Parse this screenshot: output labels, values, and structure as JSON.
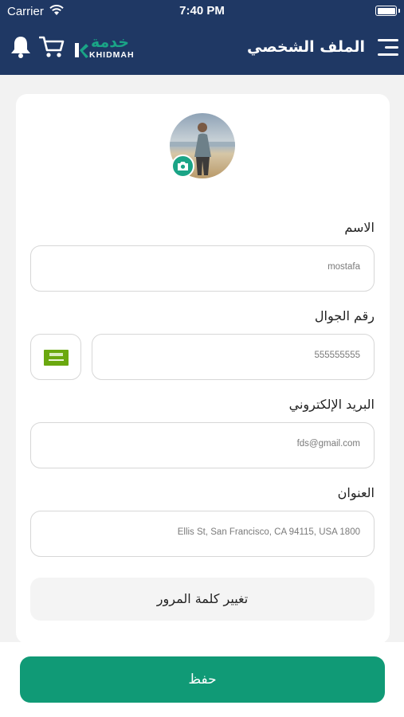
{
  "status_bar": {
    "carrier": "Carrier",
    "time": "7:40 PM"
  },
  "header": {
    "title": "الملف الشخصي",
    "logo_arabic": "خدمة",
    "logo_english": "KHIDMAH",
    "icons": [
      "menu-icon",
      "cart-icon",
      "bell-icon"
    ]
  },
  "profile": {
    "avatar": "profile-photo",
    "camera_icon": "camera-icon"
  },
  "form": {
    "name": {
      "label": "الاسم",
      "value": "mostafa"
    },
    "phone": {
      "label": "رقم الجوال",
      "value": "555555555",
      "country_flag": "saudi-flag-icon"
    },
    "email": {
      "label": "البريد الإلكتروني",
      "value": "fds@gmail.com"
    },
    "address": {
      "label": "العنوان",
      "value": "Ellis St, San Francisco, CA 94115, USA 1800"
    },
    "change_password": "تغيير كلمة المرور"
  },
  "save_button": "حفظ",
  "colors": {
    "header_bg": "#1f3864",
    "accent": "#109a76",
    "logo_green": "#1aa486"
  }
}
